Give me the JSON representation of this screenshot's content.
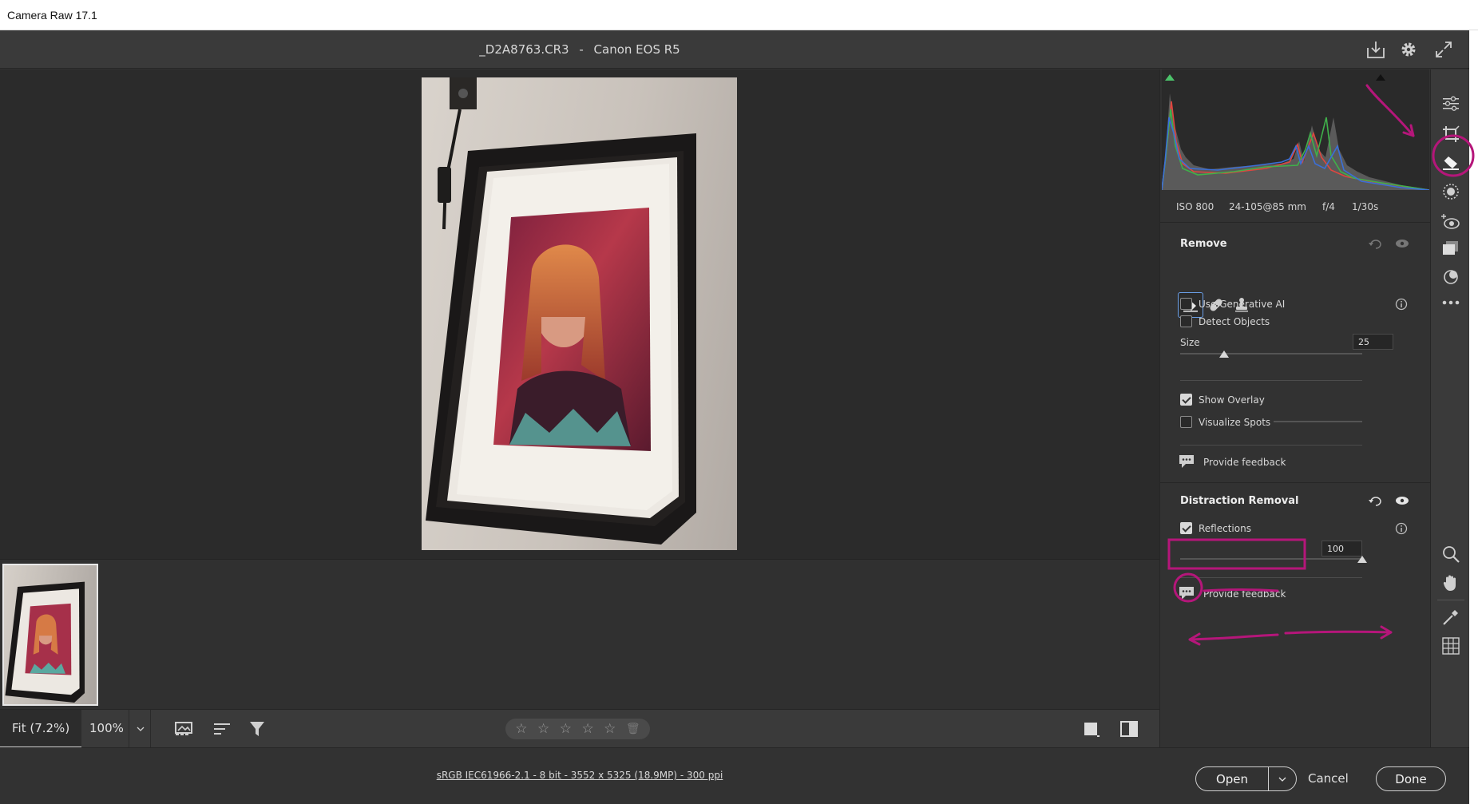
{
  "window": {
    "title": "Camera Raw 17.1"
  },
  "header": {
    "filename": "_D2A8763.CR3",
    "separator": "-",
    "camera": "Canon EOS R5",
    "icons": [
      "save-download-icon",
      "settings-gear-icon",
      "fullscreen-expand-icon"
    ]
  },
  "histogram": {
    "iso": "ISO 800",
    "lens": "24-105@85 mm",
    "aperture": "f/4",
    "shutter": "1/30s"
  },
  "remove_panel": {
    "title": "Remove",
    "tools": [
      "remove-eraser-icon",
      "heal-bandage-icon",
      "clone-stamp-icon"
    ],
    "use_generative_ai": {
      "label": "Use Generative AI",
      "checked": false
    },
    "detect_objects": {
      "label": "Detect Objects",
      "checked": false
    },
    "size": {
      "label": "Size",
      "value": "25",
      "slider_fraction": 0.24
    },
    "show_overlay": {
      "label": "Show Overlay",
      "checked": true
    },
    "visualize_spots": {
      "label": "Visualize Spots",
      "checked": false
    },
    "feedback": "Provide feedback"
  },
  "distraction_panel": {
    "title": "Distraction Removal",
    "reflections": {
      "label": "Reflections",
      "checked": true
    },
    "amount": {
      "value": "100",
      "slider_fraction": 1.0
    },
    "feedback": "Provide feedback"
  },
  "bottom_bar": {
    "zoom_fit": "Fit (7.2%)",
    "zoom_100": "100%",
    "stars": [
      "☆",
      "☆",
      "☆",
      "☆",
      "☆"
    ],
    "rating_value": 0
  },
  "footer": {
    "image_info": "sRGB IEC61966-2.1 - 8 bit - 3552 x 5325 (18.9MP) - 300 ppi",
    "open": "Open",
    "cancel": "Cancel",
    "done": "Done"
  },
  "tool_rail": [
    "edit-sliders-icon",
    "crop-icon",
    "remove-eraser-icon",
    "masking-icon",
    "red-eye-icon",
    "snapshots-icon",
    "presets-icon",
    "more-icon",
    "zoom-icon",
    "hand-icon",
    "color-sampler-icon",
    "grid-icon"
  ],
  "colors": {
    "annotation_magenta": "#b5167a",
    "app_bg": "#323232",
    "panel_bg": "#323232",
    "active_tool_blue": "#6a9fe8"
  }
}
